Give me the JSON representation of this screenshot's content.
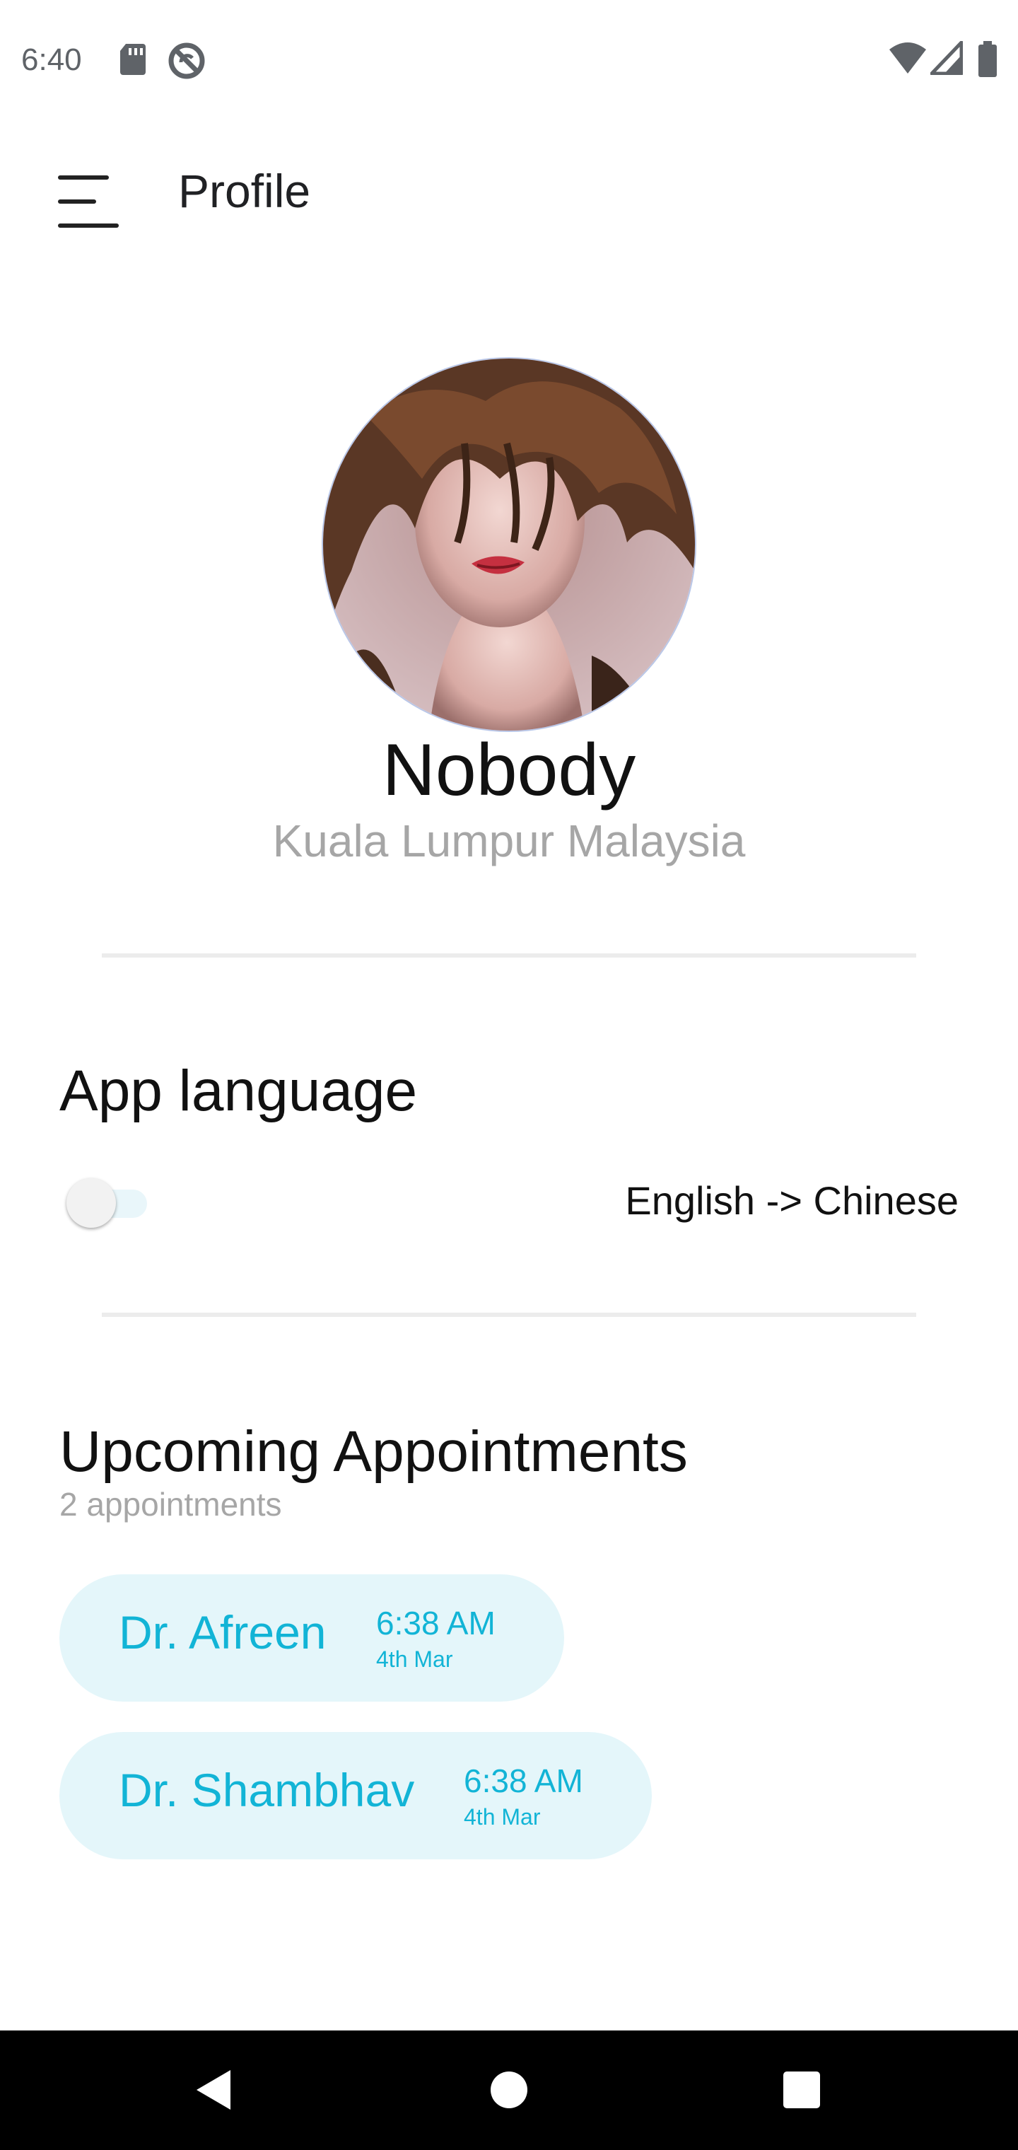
{
  "status_bar": {
    "time": "6:40",
    "icons_left": [
      "sd-card-icon",
      "do-not-disturb-icon"
    ],
    "icons_right": [
      "wifi-icon",
      "cell-signal-icon",
      "battery-icon"
    ]
  },
  "app_bar": {
    "menu_icon": "menu-icon",
    "title": "Profile"
  },
  "profile": {
    "name": "Nobody",
    "location": "Kuala Lumpur Malaysia",
    "avatar": "profile-photo"
  },
  "language": {
    "title": "App language",
    "toggle_on": false,
    "label": "English -> Chinese"
  },
  "appointments": {
    "title": "Upcoming Appointments",
    "count": "2 appointments",
    "items": [
      {
        "doctor": "Dr. Afreen",
        "time": "6:38 AM",
        "date": "4th Mar"
      },
      {
        "doctor": "Dr. Shambhav",
        "time": "6:38 AM",
        "date": "4th Mar"
      }
    ]
  },
  "nav": {
    "buttons": [
      "back-icon",
      "home-icon",
      "recents-icon"
    ]
  },
  "colors": {
    "accent": "#12b4d6",
    "card_bg": "#e4f6fa",
    "muted_text": "#a6a6a6"
  }
}
